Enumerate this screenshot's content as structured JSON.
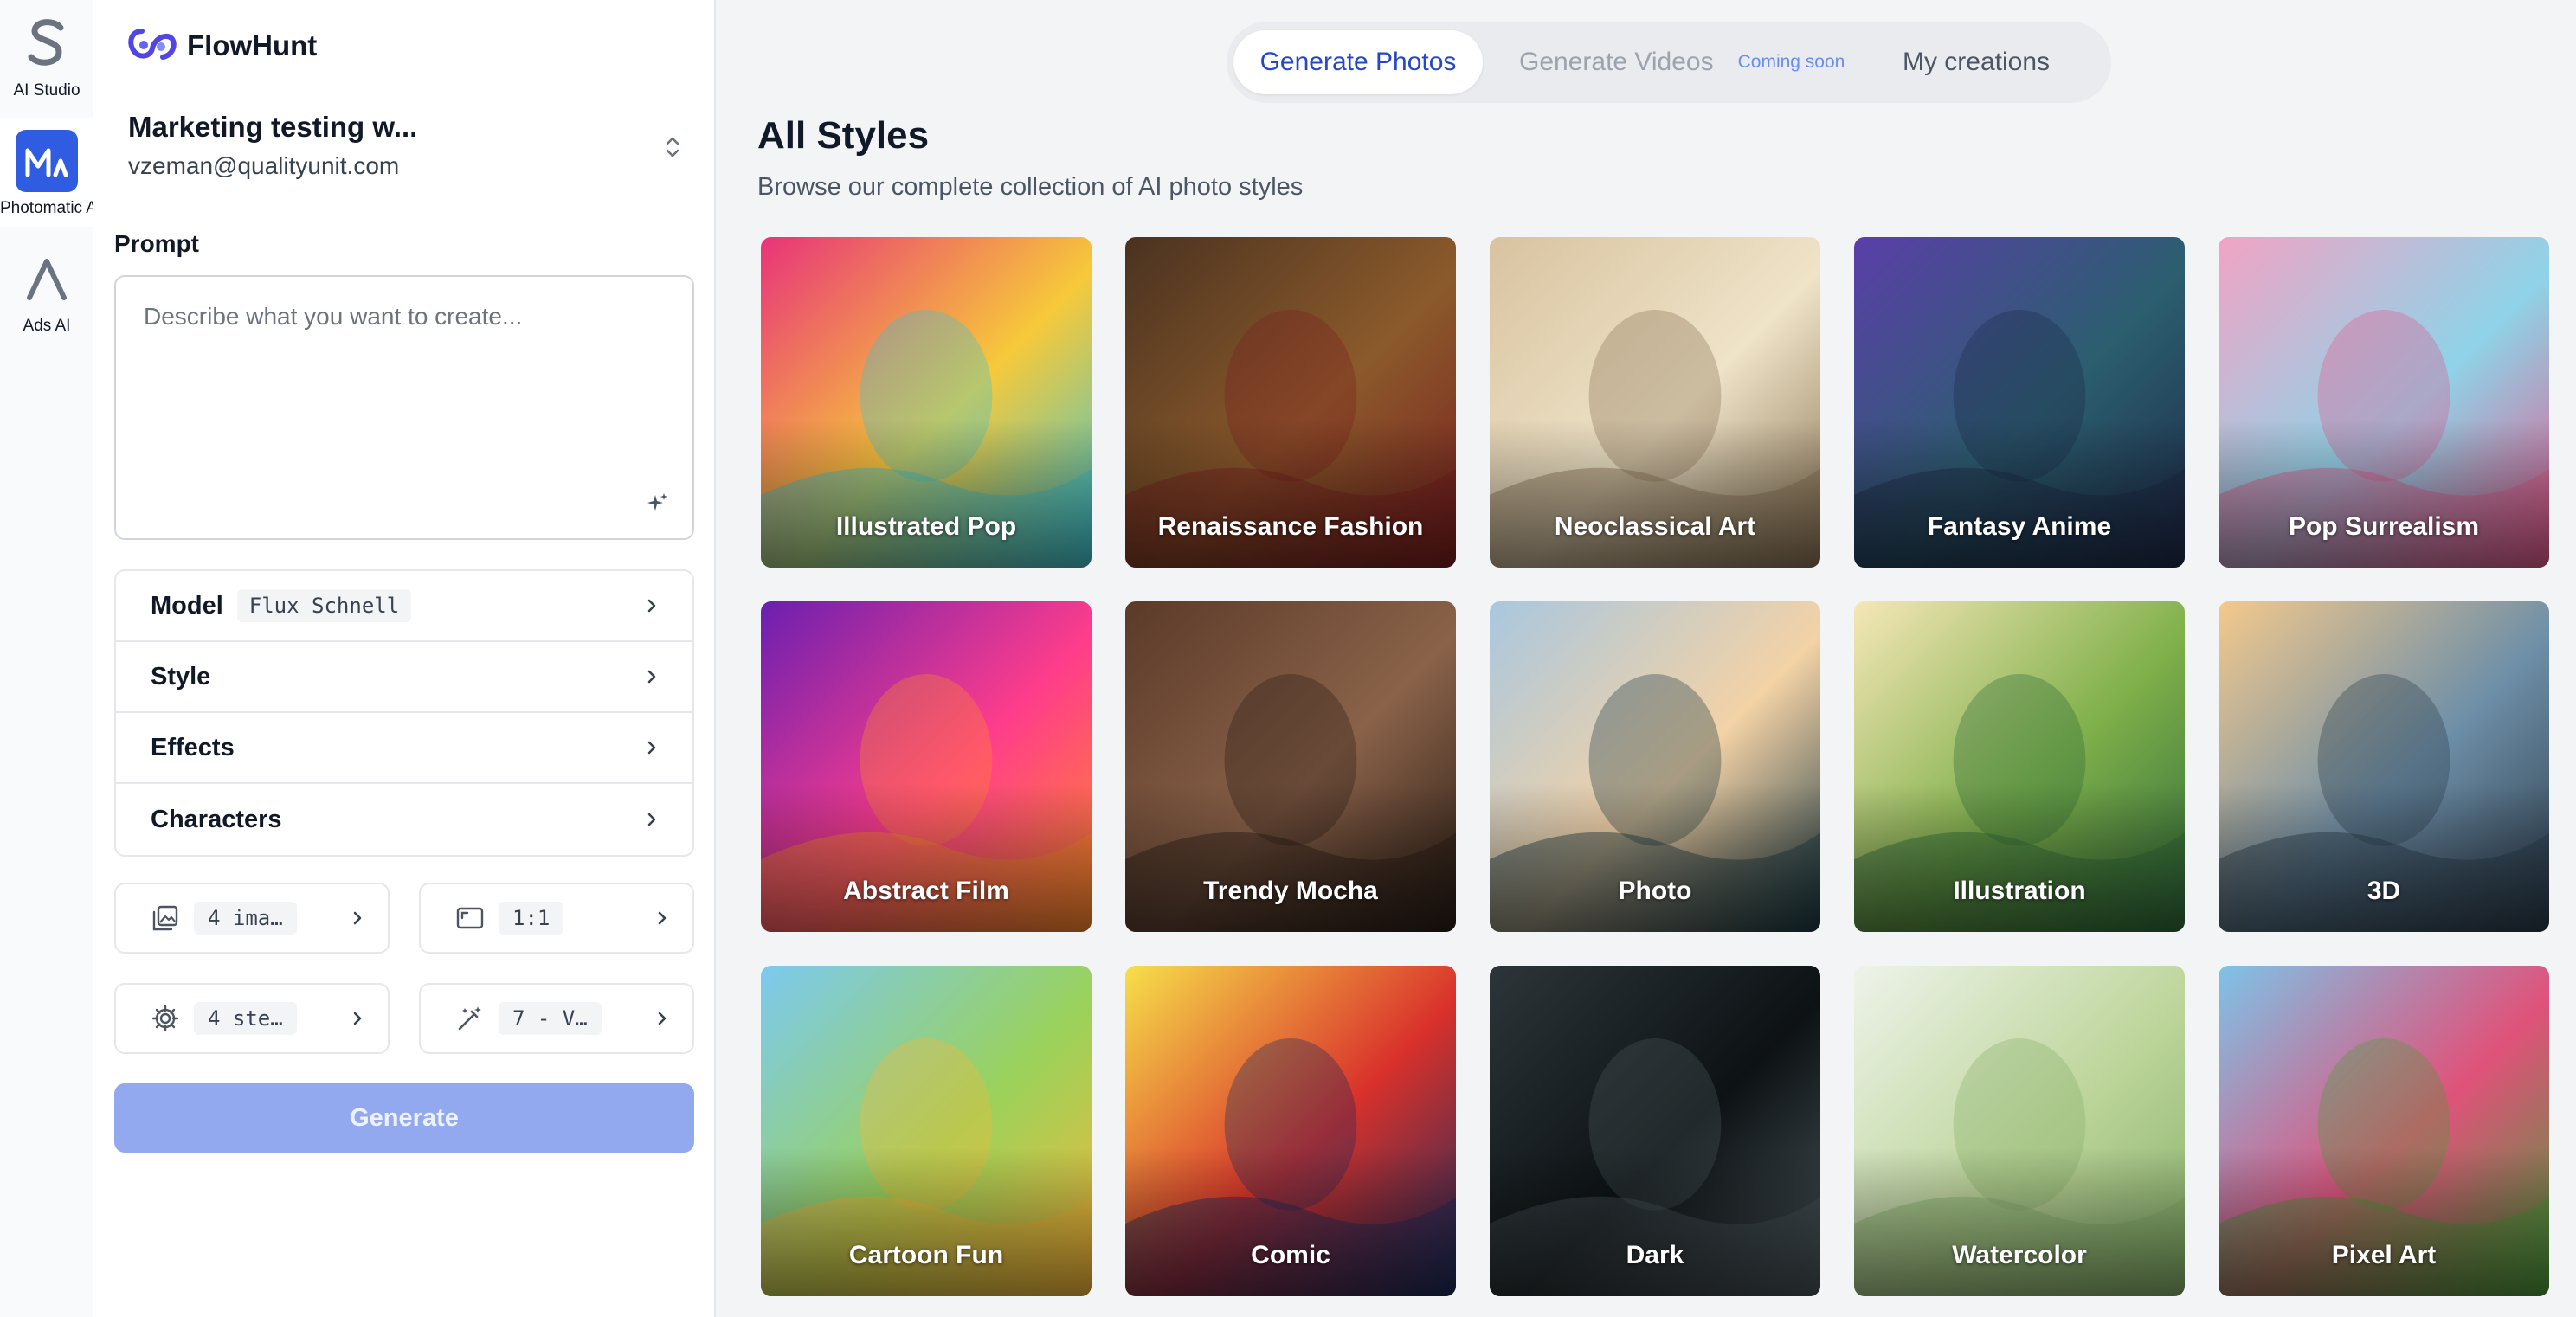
{
  "rail": {
    "items": [
      {
        "label": "AI Studio",
        "icon": "studio-s-icon",
        "active": false
      },
      {
        "label": "Photomatic AI",
        "icon": "photomatic-logo-icon",
        "active": true
      },
      {
        "label": "Ads AI",
        "icon": "ads-a-icon",
        "active": false
      }
    ]
  },
  "brand": {
    "name": "FlowHunt"
  },
  "workspace": {
    "name": "Marketing testing w...",
    "email": "vzeman@qualityunit.com"
  },
  "prompt": {
    "label": "Prompt",
    "placeholder": "Describe what you want to create...",
    "value": ""
  },
  "settings": {
    "model_label": "Model",
    "model_value": "Flux Schnell",
    "style_label": "Style",
    "effects_label": "Effects",
    "characters_label": "Characters"
  },
  "options": {
    "images": "4 ima…",
    "aspect": "1:1",
    "steps": "4 ste…",
    "quality": "7 - V…"
  },
  "generate_label": "Generate",
  "tabs": {
    "photos": "Generate Photos",
    "videos": "Generate Videos",
    "coming_soon": "Coming soon",
    "mine": "My creations"
  },
  "gallery": {
    "title": "All Styles",
    "subtitle": "Browse our complete collection of AI photo styles",
    "styles": [
      {
        "label": "Illustrated Pop",
        "colors": [
          "#e8337a",
          "#f7c93a",
          "#3ec4d0"
        ]
      },
      {
        "label": "Renaissance Fashion",
        "colors": [
          "#4a3220",
          "#8b5a2b",
          "#7a1f1f"
        ]
      },
      {
        "label": "Neoclassical Art",
        "colors": [
          "#d8c3a0",
          "#efe3c8",
          "#8a7455"
        ]
      },
      {
        "label": "Fantasy Anime",
        "colors": [
          "#5a3fa8",
          "#2b5e6e",
          "#1e2a4a"
        ]
      },
      {
        "label": "Pop Surrealism",
        "colors": [
          "#f2a3c4",
          "#8fd3e8",
          "#e05a8c"
        ]
      },
      {
        "label": "Abstract Film",
        "colors": [
          "#6a1fb0",
          "#ff3d8b",
          "#ff8a2a"
        ]
      },
      {
        "label": "Trendy Mocha",
        "colors": [
          "#5b3a29",
          "#8a6249",
          "#2a1d16"
        ]
      },
      {
        "label": "Photo",
        "colors": [
          "#a9c7df",
          "#f3d2a6",
          "#1d3a42"
        ]
      },
      {
        "label": "Illustration",
        "colors": [
          "#f6e7b8",
          "#7fb04a",
          "#2f6b3a"
        ]
      },
      {
        "label": "3D",
        "colors": [
          "#f4c98c",
          "#6e8fa8",
          "#2b3b4a"
        ]
      },
      {
        "label": "Cartoon Fun",
        "colors": [
          "#7cc9f0",
          "#9ad25a",
          "#f7b73a"
        ]
      },
      {
        "label": "Comic",
        "colors": [
          "#f7e04a",
          "#d9312b",
          "#1c2a5a"
        ]
      },
      {
        "label": "Dark",
        "colors": [
          "#2c3539",
          "#0d1214",
          "#4a5559"
        ]
      },
      {
        "label": "Watercolor",
        "colors": [
          "#eef3ea",
          "#bdd59a",
          "#86b06a"
        ]
      },
      {
        "label": "Pixel Art",
        "colors": [
          "#7ec3e8",
          "#e0527a",
          "#4c9a3a"
        ]
      }
    ]
  }
}
